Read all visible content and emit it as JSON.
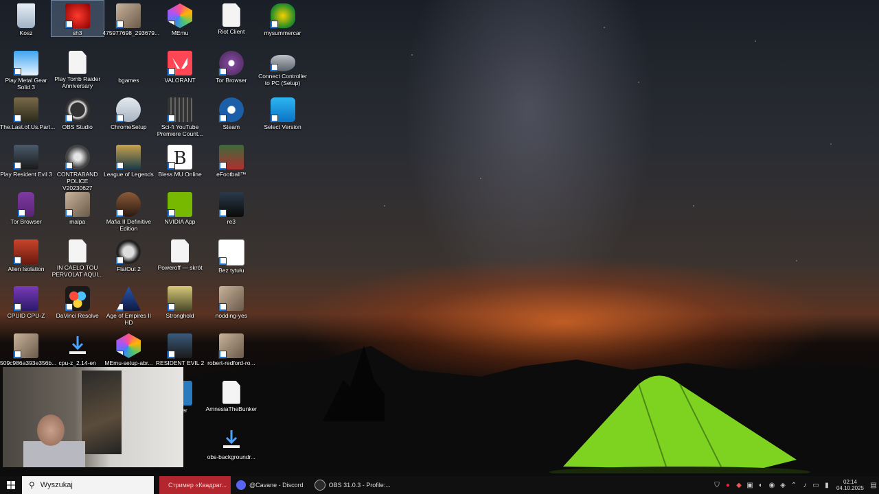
{
  "desktop_icons": [
    {
      "label": "Kosz",
      "col": 0,
      "row": 0,
      "kind": "recycle"
    },
    {
      "label": "sh3",
      "col": 1,
      "row": 0,
      "kind": "red",
      "selected": true
    },
    {
      "label": "475977698_293679...",
      "col": 2,
      "row": 0,
      "kind": "photo"
    },
    {
      "label": "MEmu",
      "col": 3,
      "row": 0,
      "kind": "memu"
    },
    {
      "label": "Riot Client",
      "col": 4,
      "row": 0,
      "kind": "file"
    },
    {
      "label": "mysummercar",
      "col": 5,
      "row": 0,
      "kind": "msc"
    },
    {
      "label": "Play Metal Gear Solid 3",
      "col": 0,
      "row": 1,
      "kind": "blue"
    },
    {
      "label": "Play Tomb Raider Anniversary",
      "col": 1,
      "row": 1,
      "kind": "file"
    },
    {
      "label": "bgames",
      "col": 2,
      "row": 1,
      "kind": "none"
    },
    {
      "label": "VALORANT",
      "col": 3,
      "row": 1,
      "kind": "valorant"
    },
    {
      "label": "Tor Browser",
      "col": 4,
      "row": 1,
      "kind": "tor"
    },
    {
      "label": "Connect Controller to PC (Setup)",
      "col": 5,
      "row": 1,
      "kind": "gamepad"
    },
    {
      "label": "The.Last.of.Us.Part...",
      "col": 0,
      "row": 2,
      "kind": "tlou"
    },
    {
      "label": "OBS Studio",
      "col": 1,
      "row": 2,
      "kind": "obs"
    },
    {
      "label": "ChromeSetup",
      "col": 2,
      "row": 2,
      "kind": "chrome"
    },
    {
      "label": "Sci-fi YouTube Premiere Count...",
      "col": 3,
      "row": 2,
      "kind": "film"
    },
    {
      "label": "Steam",
      "col": 4,
      "row": 2,
      "kind": "steam"
    },
    {
      "label": "Select Version",
      "col": 5,
      "row": 2,
      "kind": "selectver"
    },
    {
      "label": "Play Resident Evil 3",
      "col": 0,
      "row": 3,
      "kind": "re3"
    },
    {
      "label": "CONTRABAND POLICE V20230627",
      "col": 1,
      "row": 3,
      "kind": "police"
    },
    {
      "label": "League of Legends",
      "col": 2,
      "row": 3,
      "kind": "lol"
    },
    {
      "label": "Bless MU Online",
      "col": 3,
      "row": 3,
      "kind": "bless"
    },
    {
      "label": "eFootball™",
      "col": 4,
      "row": 3,
      "kind": "efootball"
    },
    {
      "label": "Tor Browser",
      "col": 0,
      "row": 4,
      "kind": "torpurple"
    },
    {
      "label": "malpa",
      "col": 1,
      "row": 4,
      "kind": "photo"
    },
    {
      "label": "Mafia II Definitive Edition",
      "col": 2,
      "row": 4,
      "kind": "mafia"
    },
    {
      "label": "NVIDIA App",
      "col": 3,
      "row": 4,
      "kind": "nvidia"
    },
    {
      "label": "re3",
      "col": 4,
      "row": 4,
      "kind": "re3dark"
    },
    {
      "label": "Alien Isolation",
      "col": 0,
      "row": 5,
      "kind": "alien"
    },
    {
      "label": "IN CAELO TOU PERVOLAT AQUI...",
      "col": 1,
      "row": 5,
      "kind": "file"
    },
    {
      "label": "FlatOut 2",
      "col": 2,
      "row": 5,
      "kind": "flatout"
    },
    {
      "label": "Poweroff — skrót",
      "col": 3,
      "row": 5,
      "kind": "file"
    },
    {
      "label": "Bez tytułu",
      "col": 4,
      "row": 5,
      "kind": "paint"
    },
    {
      "label": "CPUID CPU-Z",
      "col": 0,
      "row": 6,
      "kind": "cpuz"
    },
    {
      "label": "DaVinci Resolve",
      "col": 1,
      "row": 6,
      "kind": "davinci"
    },
    {
      "label": "Age of Empires II HD",
      "col": 2,
      "row": 6,
      "kind": "aoe"
    },
    {
      "label": "Stronghold",
      "col": 3,
      "row": 6,
      "kind": "stronghold"
    },
    {
      "label": "nodding-yes",
      "col": 4,
      "row": 6,
      "kind": "photo"
    },
    {
      "label": "509c986a393e356b...",
      "col": 0,
      "row": 7,
      "kind": "photo"
    },
    {
      "label": "cpu-z_2.14-en",
      "col": 1,
      "row": 7,
      "kind": "download"
    },
    {
      "label": "MEmu-setup-abr...",
      "col": 2,
      "row": 7,
      "kind": "memu"
    },
    {
      "label": "RESIDENT EVIL 2",
      "col": 3,
      "row": 7,
      "kind": "re2"
    },
    {
      "label": "robert-redford-ro...",
      "col": 4,
      "row": 7,
      "kind": "photo"
    },
    {
      "label": "ncher",
      "col": 3,
      "row": 8,
      "kind": "launcher"
    },
    {
      "label": "AmnesiaTheBunker",
      "col": 4,
      "row": 8,
      "kind": "file"
    },
    {
      "label": "obs-backgroundr...",
      "col": 4,
      "row": 9,
      "kind": "download"
    }
  ],
  "taskbar": {
    "search_placeholder": "Wyszukaj",
    "apps": [
      {
        "label": "Стример «Квадрат...",
        "active": true,
        "color": "#e2464a"
      },
      {
        "label": "@Cavane - Discord",
        "active": false,
        "color": "#5865f2"
      },
      {
        "label": "OBS 31.0.3 - Profile:...",
        "active": false,
        "color": "#2b2b2b"
      }
    ],
    "clock_time": "02:14",
    "clock_date": "04.10.2025"
  },
  "colors": {
    "taskbar_active": "#b3262e",
    "selection": "#5f85b8"
  }
}
